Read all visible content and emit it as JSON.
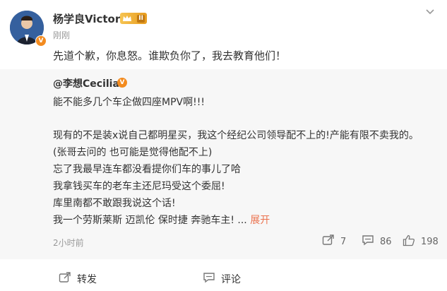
{
  "post": {
    "author": "杨学良Victor",
    "badge_level": "II",
    "time": "刚刚",
    "text": "先道个歉，你息怒。谁欺负你了，我去教育他们！"
  },
  "retweet": {
    "author": "@李想Cecilia",
    "lines": [
      "能不能多几个车企做四座MPV啊!!!",
      "",
      "现有的不是装x说自己都明星买，我这个经纪公司领导配不上的!产能有限不卖我的。",
      "(张哥去问的 也可能是觉得他配不上)",
      "忘了我最早连车都没看提你们车的事儿了哈",
      "我拿钱买车的老车主还尼玛受这个委屈!",
      "库里南都不敢跟我说这个话!",
      "我一个劳斯莱斯 迈凯伦 保时捷 奔驰车主! ..."
    ],
    "expand_label": "展开",
    "time": "2小时前",
    "reposts": "7",
    "comments": "86",
    "likes": "198"
  },
  "actions": {
    "repost_label": "转发",
    "comment_label": "评论"
  },
  "icons": [
    "avatar",
    "verified-badge-icon",
    "crown-badge-icon",
    "chevron-down-icon",
    "repost-icon",
    "comment-icon",
    "like-icon"
  ],
  "colors": {
    "accent": "#eb7350",
    "verified": "#f38b1f",
    "retweet_bg": "#f7f7f7"
  }
}
